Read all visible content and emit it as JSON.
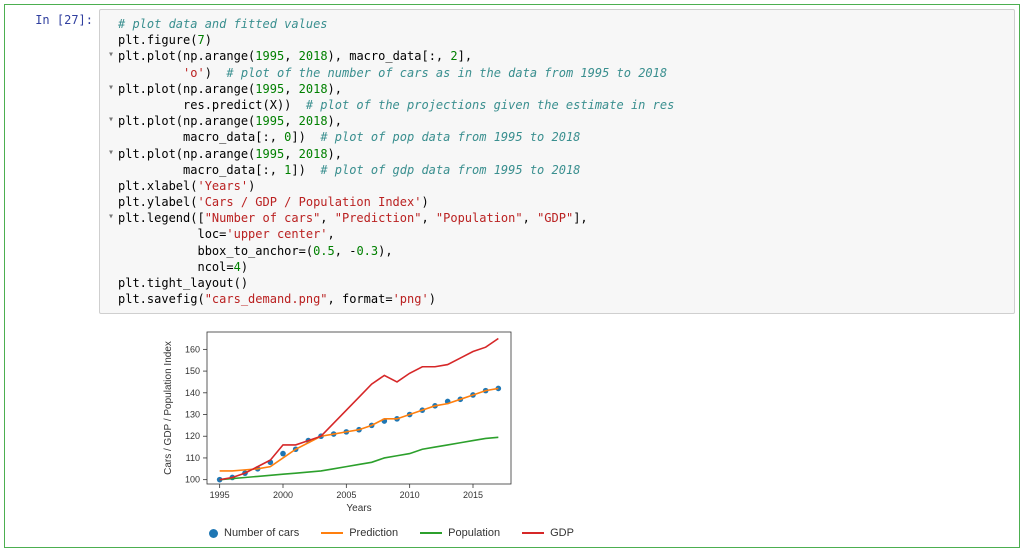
{
  "cell": {
    "prompt": "In [27]:",
    "code_lines": [
      {
        "gutter": "",
        "html": "<span class='tok-cmt'># plot data and fitted values</span>"
      },
      {
        "gutter": "",
        "html": "plt.figure(<span class='tok-num'>7</span>)"
      },
      {
        "gutter": "▾",
        "html": "plt.plot(np.arange(<span class='tok-num'>1995</span>, <span class='tok-num'>2018</span>), macro_data[:, <span class='tok-num'>2</span>],"
      },
      {
        "gutter": "",
        "html": "         <span class='tok-str'>'o'</span>)  <span class='tok-cmt'># plot of the number of cars as in the data from 1995 to 2018</span>"
      },
      {
        "gutter": "▾",
        "html": "plt.plot(np.arange(<span class='tok-num'>1995</span>, <span class='tok-num'>2018</span>),"
      },
      {
        "gutter": "",
        "html": "         res.predict(X))  <span class='tok-cmt'># plot of the projections given the estimate in res</span>"
      },
      {
        "gutter": "▾",
        "html": "plt.plot(np.arange(<span class='tok-num'>1995</span>, <span class='tok-num'>2018</span>),"
      },
      {
        "gutter": "",
        "html": "         macro_data[:, <span class='tok-num'>0</span>])  <span class='tok-cmt'># plot of pop data from 1995 to 2018</span>"
      },
      {
        "gutter": "▾",
        "html": "plt.plot(np.arange(<span class='tok-num'>1995</span>, <span class='tok-num'>2018</span>),"
      },
      {
        "gutter": "",
        "html": "         macro_data[:, <span class='tok-num'>1</span>])  <span class='tok-cmt'># plot of gdp data from 1995 to 2018</span>"
      },
      {
        "gutter": "",
        "html": "plt.xlabel(<span class='tok-str'>'Years'</span>)"
      },
      {
        "gutter": "",
        "html": "plt.ylabel(<span class='tok-str'>'Cars / GDP / Population Index'</span>)"
      },
      {
        "gutter": "▾",
        "html": "plt.legend([<span class='tok-str'>\"Number of cars\"</span>, <span class='tok-str'>\"Prediction\"</span>, <span class='tok-str'>\"Population\"</span>, <span class='tok-str'>\"GDP\"</span>],"
      },
      {
        "gutter": "",
        "html": "           loc=<span class='tok-str'>'upper center'</span>,"
      },
      {
        "gutter": "",
        "html": "           bbox_to_anchor=(<span class='tok-num'>0.5</span>, -<span class='tok-num'>0.3</span>),"
      },
      {
        "gutter": "",
        "html": "           ncol=<span class='tok-num'>4</span>)"
      },
      {
        "gutter": "",
        "html": "plt.tight_layout()"
      },
      {
        "gutter": "",
        "html": "plt.savefig(<span class='tok-str'>\"cars_demand.png\"</span>, format=<span class='tok-str'>'png'</span>)"
      }
    ]
  },
  "chart_data": {
    "type": "line",
    "xlabel": "Years",
    "ylabel": "Cars / GDP / Population Index",
    "xlim": [
      1994,
      2018
    ],
    "ylim": [
      98,
      168
    ],
    "xticks": [
      1995,
      2000,
      2005,
      2010,
      2015
    ],
    "yticks": [
      100,
      110,
      120,
      130,
      140,
      150,
      160
    ],
    "x": [
      1995,
      1996,
      1997,
      1998,
      1999,
      2000,
      2001,
      2002,
      2003,
      2004,
      2005,
      2006,
      2007,
      2008,
      2009,
      2010,
      2011,
      2012,
      2013,
      2014,
      2015,
      2016,
      2017
    ],
    "series": [
      {
        "name": "Number of cars",
        "style": "dots",
        "color": "#1f77b4",
        "values": [
          100,
          101,
          103,
          105,
          108,
          112,
          114,
          118,
          120,
          121,
          122,
          123,
          125,
          127,
          128,
          130,
          132,
          134,
          136,
          137,
          139,
          141,
          142
        ]
      },
      {
        "name": "Prediction",
        "style": "line",
        "color": "#ff7f0e",
        "values": [
          104,
          104,
          104.5,
          105,
          106,
          110,
          114,
          117,
          120,
          121,
          122,
          123,
          125,
          128,
          128,
          130,
          132,
          134,
          135,
          137,
          139,
          141,
          142
        ]
      },
      {
        "name": "Population",
        "style": "line",
        "color": "#2ca02c",
        "values": [
          100,
          100.5,
          101,
          101.5,
          102,
          102.5,
          103,
          103.5,
          104,
          105,
          106,
          107,
          108,
          110,
          111,
          112,
          114,
          115,
          116,
          117,
          118,
          119,
          119.5
        ]
      },
      {
        "name": "GDP",
        "style": "line",
        "color": "#d62728",
        "values": [
          100,
          101,
          103,
          106,
          109,
          116,
          116,
          118,
          120,
          126,
          132,
          138,
          144,
          148,
          145,
          149,
          152,
          152,
          153,
          156,
          159,
          161,
          165
        ]
      }
    ],
    "legend": {
      "position": "below",
      "ncol": 4,
      "items": [
        "Number of cars",
        "Prediction",
        "Population",
        "GDP"
      ]
    }
  },
  "colors": {
    "cars": "#1f77b4",
    "pred": "#ff7f0e",
    "pop": "#2ca02c",
    "gdp": "#d62728"
  }
}
